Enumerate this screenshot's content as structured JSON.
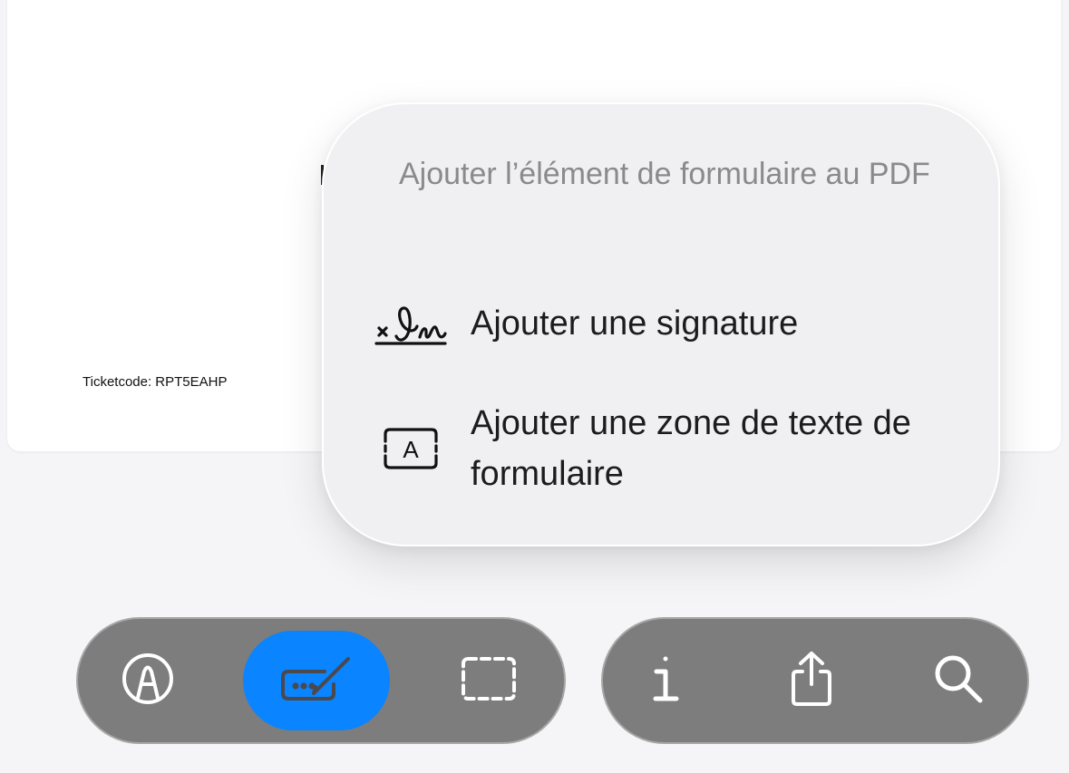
{
  "document": {
    "ticket_code": "Ticketcode: RPT5EAHP"
  },
  "popover": {
    "title": "Ajouter l’élément de formulaire au PDF",
    "items": [
      {
        "label": "Ajouter une signature",
        "icon": "signature-icon"
      },
      {
        "label": "Ajouter une zone de texte de formulaire",
        "icon": "text-box-icon"
      }
    ]
  },
  "toolbar": {
    "left": [
      {
        "icon": "markup-pen-icon",
        "active": false
      },
      {
        "icon": "form-fill-icon",
        "active": true
      },
      {
        "icon": "selection-icon",
        "active": false
      }
    ],
    "right": [
      {
        "icon": "info-icon"
      },
      {
        "icon": "share-icon"
      },
      {
        "icon": "search-icon"
      }
    ]
  },
  "colors": {
    "accent": "#0a84ff",
    "toolbar": "#7d7d7d",
    "popover": "#f0f0f2"
  }
}
